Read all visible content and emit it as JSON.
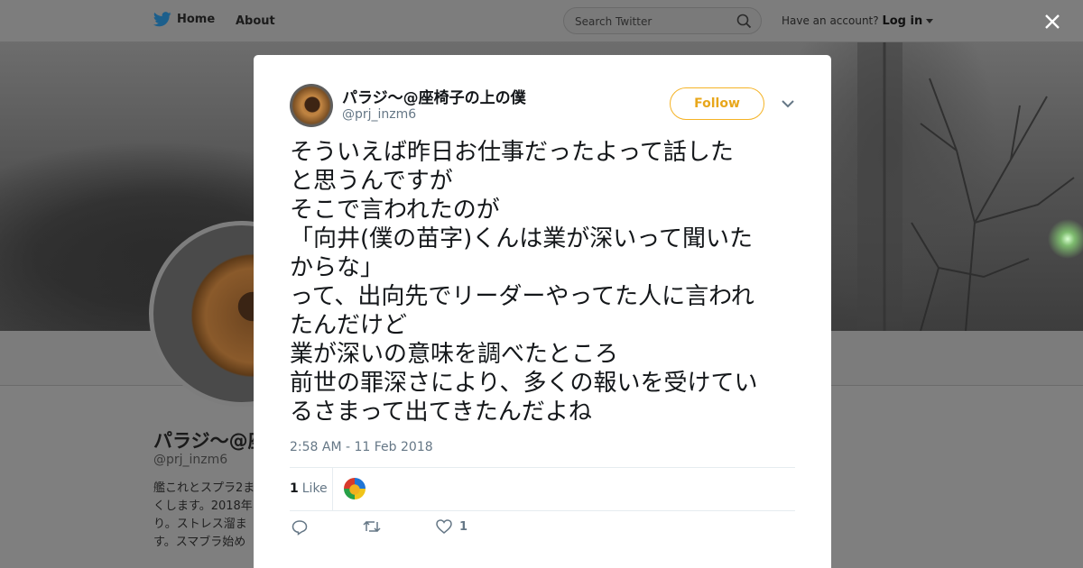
{
  "nav": {
    "home_label": "Home",
    "about_label": "About",
    "search_placeholder": "Search Twitter",
    "account_prompt": "Have an account?",
    "login_label": "Log in"
  },
  "profile": {
    "name": "パラジ～@座椅子の上の僕",
    "handle": "@prj_inzm6",
    "bio_visible": "艦これとスプラ2ま くします。2018年 り。ストレス溜ま す。スマブラ始め"
  },
  "tweet": {
    "author_name": "パラジ～@座椅子の上の僕",
    "author_handle": "@prj_inzm6",
    "follow_label": "Follow",
    "text": "そういえば昨日お仕事だったよって話した\nと思うんですが\nそこで言われたのが\n「向井(僕の苗字)くんは業が深いって聞いた\nからな」\nって、出向先でリーダーやってた人に言われ\nたんだけど\n業が深いの意味を調べたところ\n前世の罪深さにより、多くの報いを受けてい\nるさまって出てきたんだよね",
    "timestamp": "2:58 AM - 11 Feb 2018",
    "like_count": "1",
    "like_label": "Like",
    "action_like_count": "1"
  },
  "colors": {
    "twitter_blue": "#1da1f2",
    "follow_accent": "#f5b325",
    "secondary_text": "#657786",
    "overlay": "#7f7f7f"
  }
}
